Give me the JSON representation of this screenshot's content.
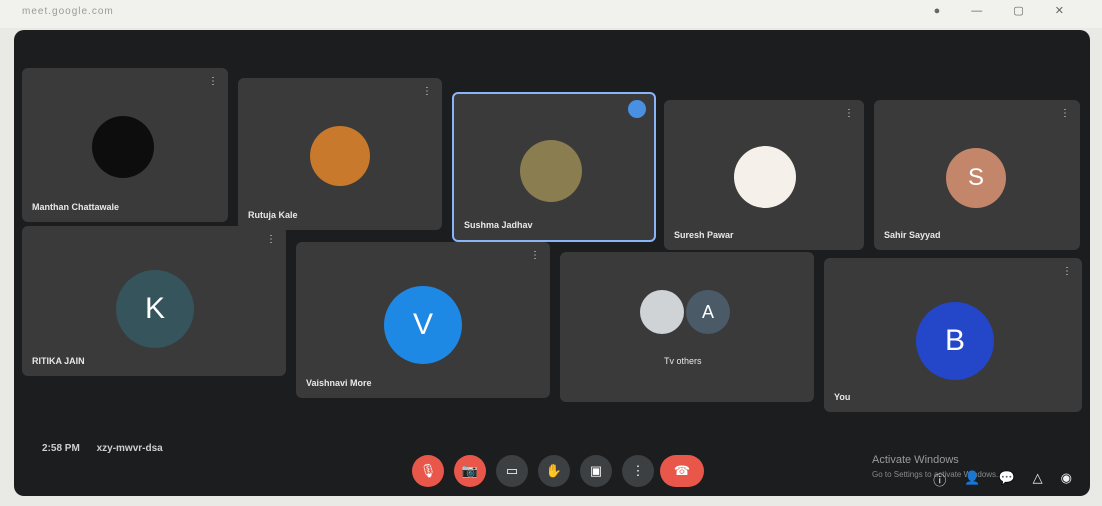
{
  "browser": {
    "url_text": "meet.google.com",
    "controls": "● — ▢ ✕"
  },
  "participants_row1": [
    {
      "name": "Manthan Chattawale",
      "avatar": "",
      "color": "#0e0d0d"
    },
    {
      "name": "Rutuja Kale",
      "avatar": "",
      "color": "#c8792b"
    },
    {
      "name": "Sushma Jadhav",
      "avatar": "",
      "color": "#8a7d4f"
    },
    {
      "name": "Suresh Pawar",
      "avatar": "",
      "color": "#f5f0ea"
    },
    {
      "name": "Sahir Sayyad",
      "avatar": "S",
      "color": "#c4866a"
    }
  ],
  "participants_row2": [
    {
      "name": "RITIKA JAIN",
      "avatar": "K",
      "color": "#36545c"
    },
    {
      "name": "Vaishnavi More",
      "avatar": "V",
      "color": "#1e88e5"
    },
    {
      "name": "Tv others",
      "avatar": "A",
      "color": "#4a5a66"
    },
    {
      "name": "You",
      "avatar": "B",
      "color": "#2446c9"
    }
  ],
  "meeting": {
    "time": "2:58 PM",
    "code": "xzy-mwvr-dsa"
  },
  "controls": {
    "mic_icon": "🎙",
    "cam_icon": "📷",
    "captions_icon": "▭",
    "hand_icon": "✋",
    "present_icon": "▣",
    "more_icon": "⋮",
    "end_icon": "☎"
  },
  "watermark": {
    "line1": "Activate Windows",
    "line2": "Go to Settings to activate Windows."
  },
  "right_icons": [
    "ⓘ",
    "👤",
    "💬",
    "△",
    "◉"
  ]
}
